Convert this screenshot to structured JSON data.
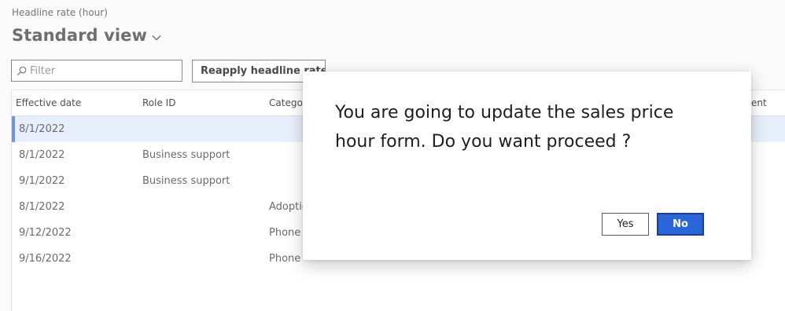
{
  "header": {
    "breadcrumb": "Headline rate (hour)",
    "view_title": "Standard view"
  },
  "toolbar": {
    "filter_placeholder": "Filter",
    "filter_value": "",
    "reapply_label": "Reapply headline rate"
  },
  "grid": {
    "columns": [
      "Effective date",
      "Role ID",
      "Category",
      "ent"
    ],
    "rows": [
      {
        "effective_date": "8/1/2022",
        "role_id": "",
        "category": "",
        "selected": true
      },
      {
        "effective_date": "8/1/2022",
        "role_id": "Business support",
        "category": ""
      },
      {
        "effective_date": "9/1/2022",
        "role_id": "Business support",
        "category": ""
      },
      {
        "effective_date": "8/1/2022",
        "role_id": "",
        "category": "Adoption"
      },
      {
        "effective_date": "9/12/2022",
        "role_id": "",
        "category": "Phone"
      },
      {
        "effective_date": "9/16/2022",
        "role_id": "",
        "category": "Phone"
      }
    ]
  },
  "dialog": {
    "message": "You are going to update the sales price hour form. Do you want proceed ?",
    "yes_label": "Yes",
    "no_label": "No"
  },
  "colors": {
    "accent": "#2a66d8",
    "selected_row": "#e8effc",
    "selected_marker": "#6f93e0"
  },
  "icons": {
    "view_chevron": "chevron-down-icon",
    "filter": "search-icon"
  }
}
